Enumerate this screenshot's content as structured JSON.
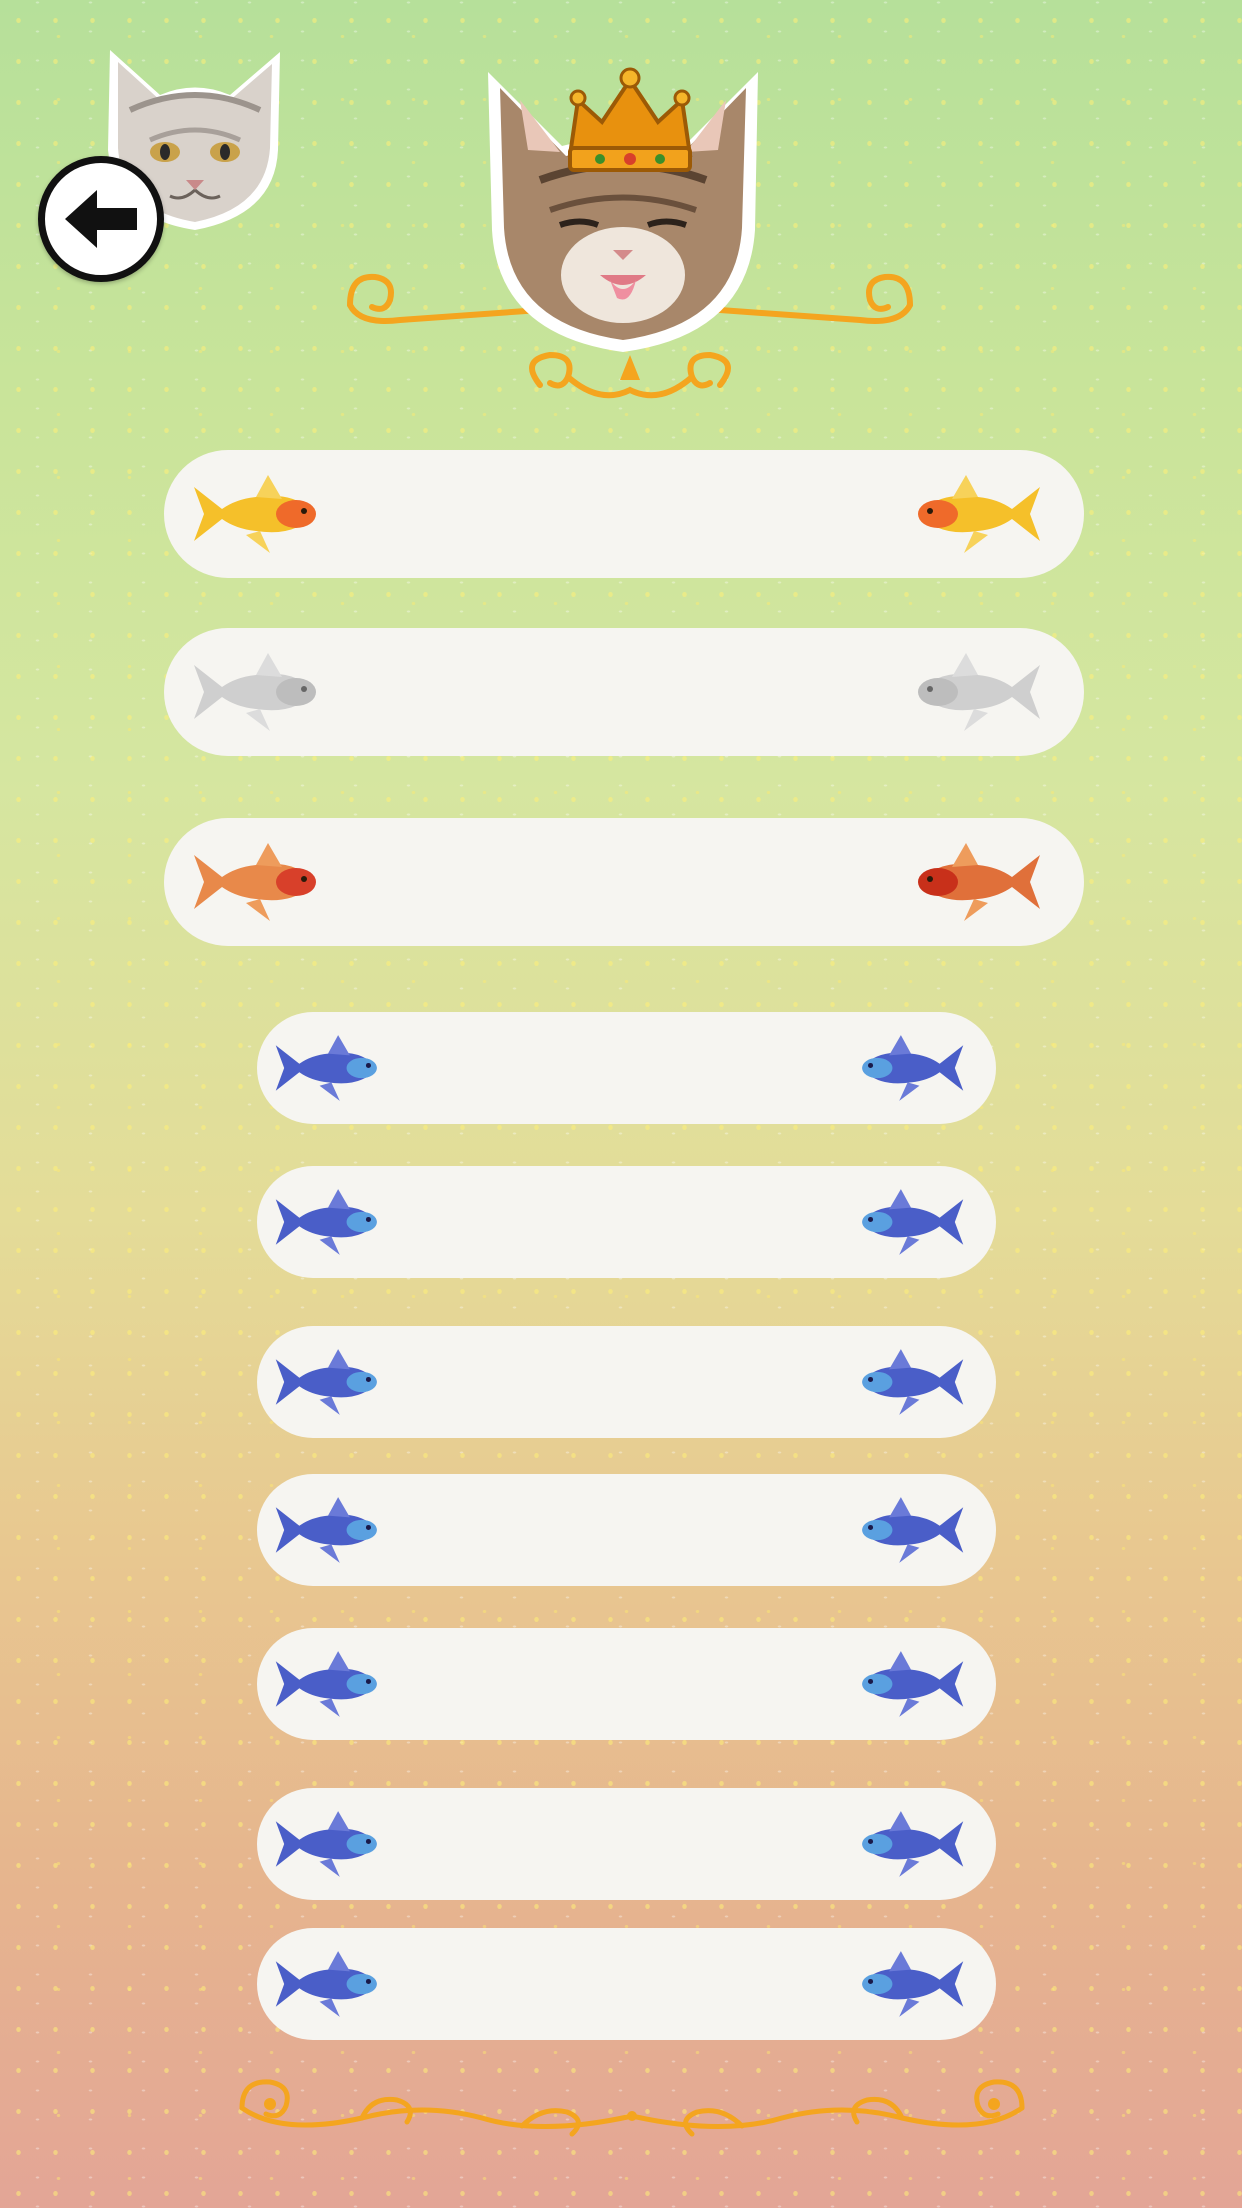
{
  "navigation": {
    "back_button": {
      "icon": "arrow-left-icon"
    }
  },
  "header": {
    "player_avatar": "cat-avatar",
    "king_avatar": "crowned-cat-avatar",
    "crown_icon": "crown-icon"
  },
  "leaderboard": {
    "rows": [
      {
        "rank_fish": "gold-fish-icon",
        "label": ""
      },
      {
        "rank_fish": "silver-fish-icon",
        "label": ""
      },
      {
        "rank_fish": "bronze-fish-icon",
        "label": ""
      },
      {
        "rank_fish": "blue-fish-icon",
        "label": ""
      },
      {
        "rank_fish": "blue-fish-icon",
        "label": ""
      },
      {
        "rank_fish": "blue-fish-icon",
        "label": ""
      },
      {
        "rank_fish": "blue-fish-icon",
        "label": ""
      },
      {
        "rank_fish": "blue-fish-icon",
        "label": ""
      },
      {
        "rank_fish": "blue-fish-icon",
        "label": ""
      },
      {
        "rank_fish": "blue-fish-icon",
        "label": ""
      }
    ]
  },
  "colors": {
    "gold": "#f5c02a",
    "silver": "#cfcfcf",
    "bronze": "#e0703a",
    "blue": "#4a5ec8",
    "ornament": "#f4a51f",
    "row_bg": "#f6f5f1"
  }
}
